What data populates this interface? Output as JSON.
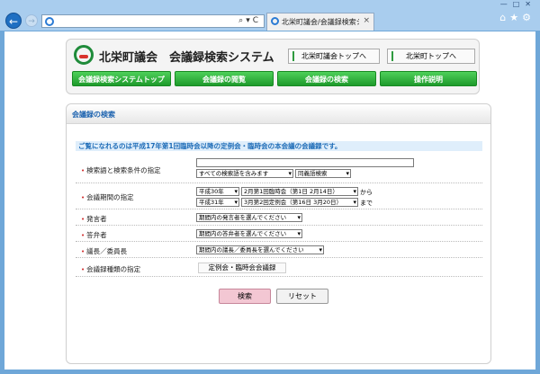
{
  "browser": {
    "back_glyph": "←",
    "forward_glyph": "→",
    "address_controls": "⌕▾C",
    "tab_title": "北栄町議会/会議録検索シ...",
    "tab_close": "×",
    "tool_icons": "⌂★⚙",
    "window_controls": "—□✕",
    "accent": "#1f6fc2"
  },
  "header": {
    "site_title": "北栄町議会　会議録検索システム",
    "links": [
      {
        "label": "北栄町議会トップへ"
      },
      {
        "label": "北栄町トップへ"
      }
    ],
    "menu": [
      {
        "label": "会議録検索システムトップ"
      },
      {
        "label": "会議録の閲覧"
      },
      {
        "label": "会議録の検索"
      },
      {
        "label": "操作説明"
      }
    ],
    "menu_color": "#2fae3b"
  },
  "search": {
    "heading": "会議録の検索",
    "notice": "ご覧になれるのは平成17年第1回臨時会以降の定例会・臨時会の本会議の会議録です。",
    "keyword": {
      "label": "検索語と検索条件の指定",
      "value": "",
      "mode": "すべての検索語を含みます",
      "dict": "同義語検索"
    },
    "period": {
      "label": "会議期間の指定",
      "from_year": "平成30年",
      "from_session": "2月第1回臨時会（第1日 2月14日）",
      "from_suffix": "から",
      "to_year": "平成31年",
      "to_session": "3月第2回定例会（第16日 3月20日）",
      "to_suffix": "まで"
    },
    "speaker": {
      "label": "発言者",
      "value": "期間内の発言者を選んでください"
    },
    "respondent": {
      "label": "答弁者",
      "value": "期間内の答弁者を選んでください"
    },
    "chair": {
      "label": "議長／委員長",
      "value": "期間内の議長／委員長を選んでください"
    },
    "kind": {
      "label": "会議録種類の指定",
      "value": "定例会・臨時会会議録"
    },
    "buttons": {
      "search": "検索",
      "reset": "リセット"
    }
  }
}
